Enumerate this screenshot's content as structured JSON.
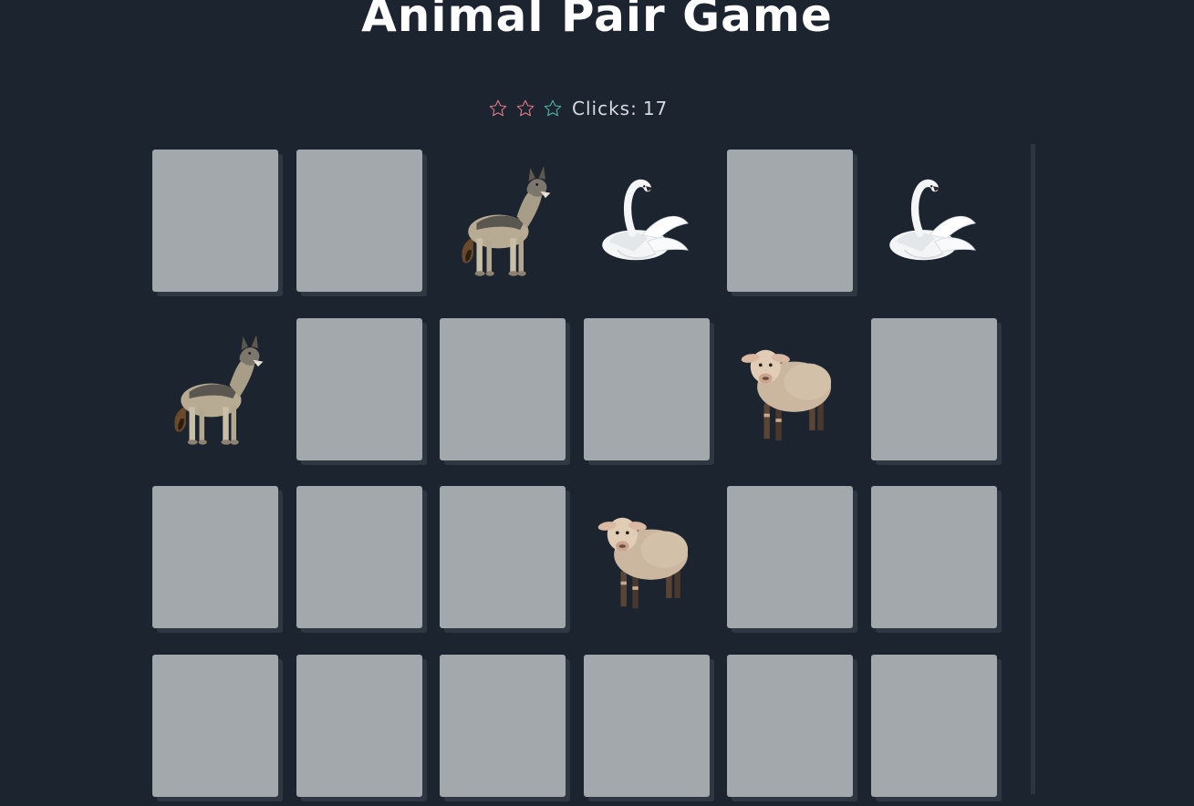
{
  "title": "Animal Pair Game",
  "status": {
    "stars": [
      {
        "name": "star-1",
        "color": "#e07a86",
        "filled": false
      },
      {
        "name": "star-2",
        "color": "#e07a86",
        "filled": false
      },
      {
        "name": "star-3",
        "color": "#4fb3a6",
        "filled": false
      }
    ],
    "clicks_label": "Clicks:",
    "clicks_value": "17"
  },
  "colors": {
    "background": "#1c2430",
    "card_back": "#a3a8ad",
    "card_shadow": "#2f3842"
  },
  "board": {
    "columns": 6,
    "rows_visible": 4,
    "cards": [
      {
        "state": "hidden",
        "animal": ""
      },
      {
        "state": "hidden",
        "animal": ""
      },
      {
        "state": "revealed",
        "animal": "wolf"
      },
      {
        "state": "revealed",
        "animal": "swan"
      },
      {
        "state": "hidden",
        "animal": ""
      },
      {
        "state": "revealed",
        "animal": "swan"
      },
      {
        "state": "revealed",
        "animal": "wolf"
      },
      {
        "state": "hidden",
        "animal": ""
      },
      {
        "state": "hidden",
        "animal": ""
      },
      {
        "state": "hidden",
        "animal": ""
      },
      {
        "state": "revealed",
        "animal": "sheep"
      },
      {
        "state": "hidden",
        "animal": ""
      },
      {
        "state": "hidden",
        "animal": ""
      },
      {
        "state": "hidden",
        "animal": ""
      },
      {
        "state": "hidden",
        "animal": ""
      },
      {
        "state": "revealed",
        "animal": "sheep"
      },
      {
        "state": "hidden",
        "animal": ""
      },
      {
        "state": "hidden",
        "animal": ""
      },
      {
        "state": "hidden",
        "animal": ""
      },
      {
        "state": "hidden",
        "animal": ""
      },
      {
        "state": "hidden",
        "animal": ""
      },
      {
        "state": "hidden",
        "animal": ""
      },
      {
        "state": "hidden",
        "animal": ""
      },
      {
        "state": "hidden",
        "animal": ""
      }
    ]
  }
}
